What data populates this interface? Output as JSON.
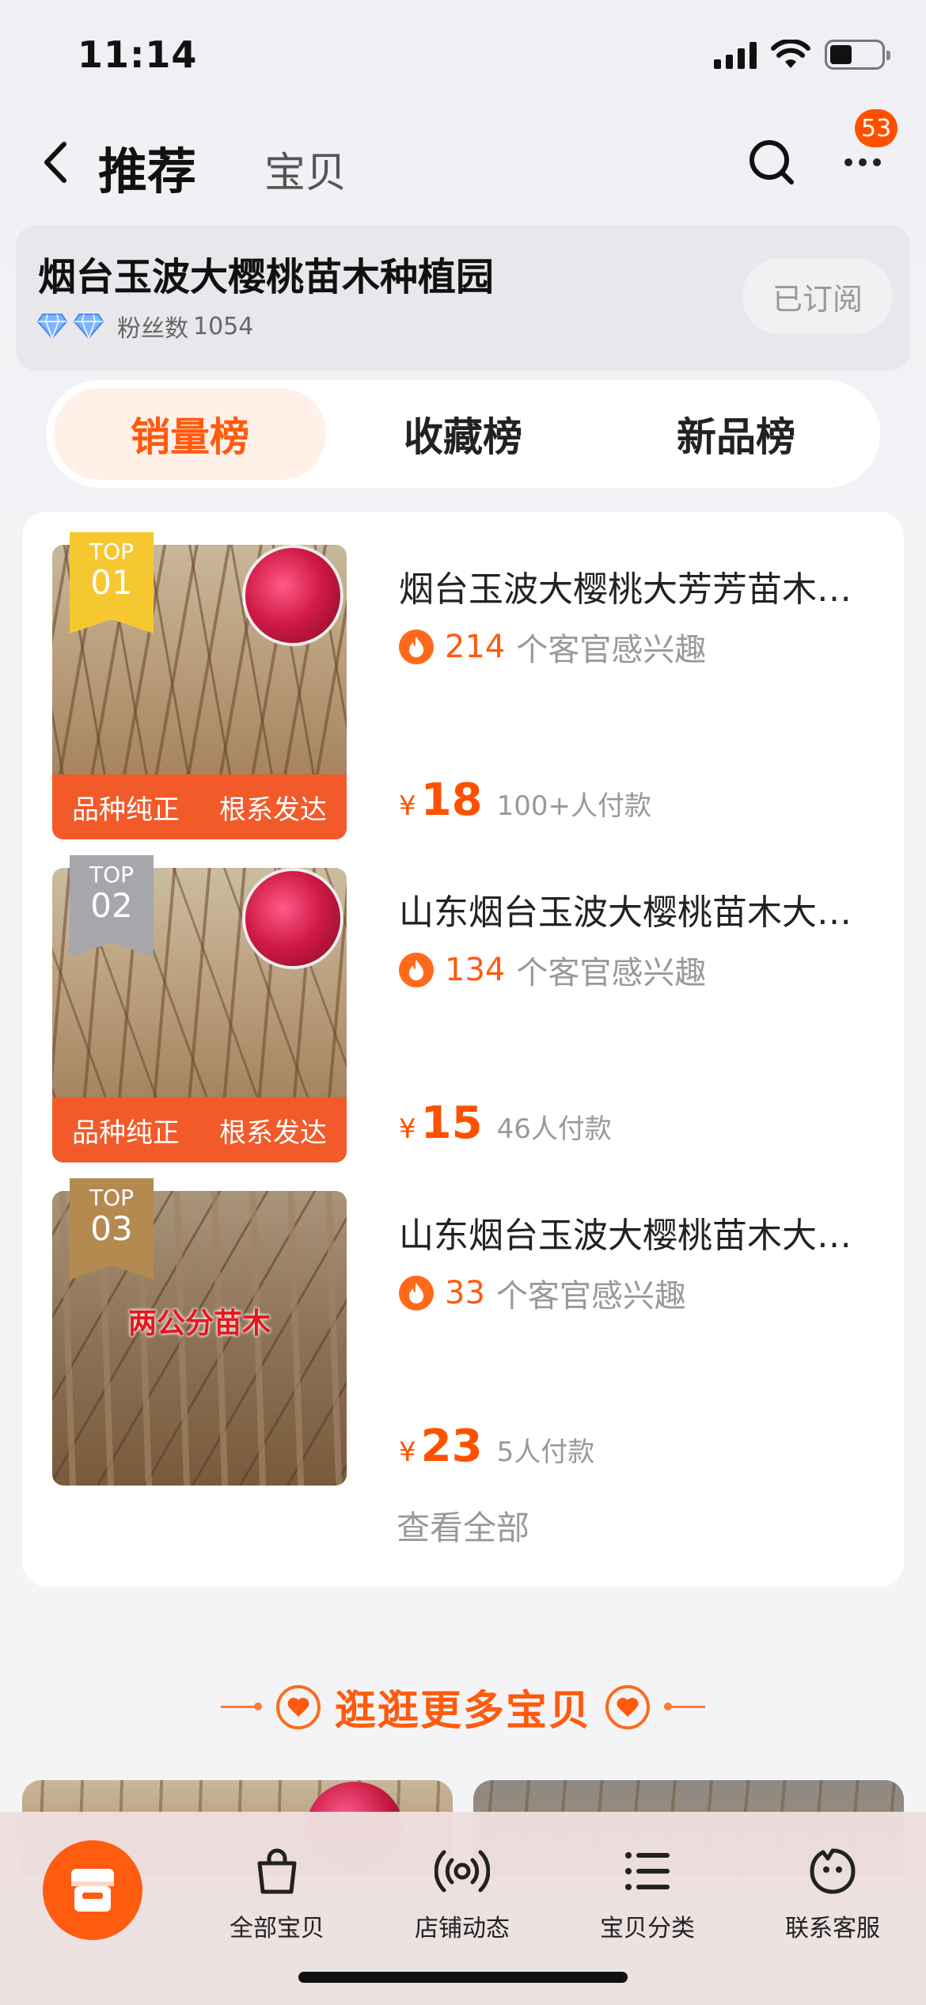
{
  "status_bar": {
    "time": "11:14"
  },
  "header": {
    "tab_active": "推荐",
    "tab_other": "宝贝",
    "message_badge": "53"
  },
  "shop": {
    "name": "烟台玉波大樱桃苗木种植园",
    "fans_label": "粉丝数",
    "fans_count": "1054",
    "subscribe_label": "已订阅",
    "diamond_color": "#6aa7ff"
  },
  "rank_tabs": [
    {
      "label": "销量榜",
      "active": true
    },
    {
      "label": "收藏榜",
      "active": false
    },
    {
      "label": "新品榜",
      "active": false
    }
  ],
  "ranking": {
    "items": [
      {
        "rank_label": "TOP",
        "rank_num": "01",
        "ribbon_color": "#f5c832",
        "title": "烟台玉波大樱桃大芳芳苗木基地直发",
        "interest_count": "214",
        "interest_text": "个客官感兴趣",
        "currency": "¥",
        "price": "18",
        "sold": "100+人付款",
        "banner_left": "品种纯正",
        "banner_right": "根系发达",
        "overlay_text": ""
      },
      {
        "rank_label": "TOP",
        "rank_num": "02",
        "ribbon_color": "#a6a6ad",
        "title": "山东烟台玉波大樱桃苗木大芳芳果苗",
        "interest_count": "134",
        "interest_text": "个客官感兴趣",
        "currency": "¥",
        "price": "15",
        "sold": "46人付款",
        "banner_left": "品种纯正",
        "banner_right": "根系发达",
        "overlay_text": ""
      },
      {
        "rank_label": "TOP",
        "rank_num": "03",
        "ribbon_color": "#b58a50",
        "title": "山东烟台玉波大樱桃苗木大芳芳苗",
        "interest_count": "33",
        "interest_text": "个客官感兴趣",
        "currency": "¥",
        "price": "23",
        "sold": "5人付款",
        "banner_left": "",
        "banner_right": "",
        "overlay_text": "两公分苗木"
      }
    ],
    "view_all": "查看全部"
  },
  "more": {
    "title": "逛逛更多宝贝"
  },
  "bottom_nav": [
    {
      "label": "全部宝贝",
      "icon": "shopping-bag-icon"
    },
    {
      "label": "店铺动态",
      "icon": "broadcast-icon"
    },
    {
      "label": "宝贝分类",
      "icon": "list-icon"
    },
    {
      "label": "联系客服",
      "icon": "service-face-icon"
    }
  ],
  "accent_color": "#ff5000"
}
